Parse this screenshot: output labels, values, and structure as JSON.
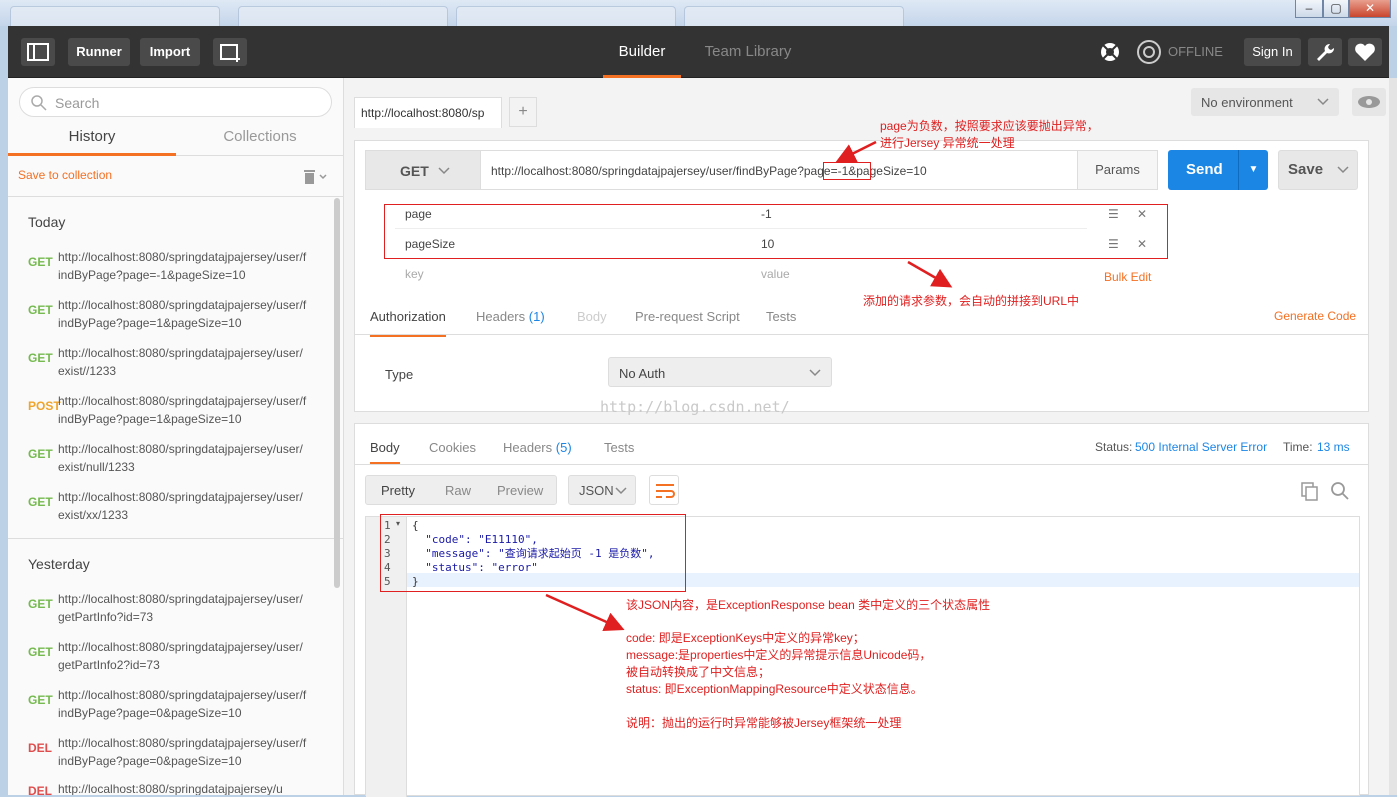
{
  "app": {
    "header": {
      "runner_label": "Runner",
      "import_label": "Import",
      "builder_tab": "Builder",
      "team_library_tab": "Team Library",
      "offline_label": "OFFLINE",
      "sign_in_label": "Sign In"
    },
    "sidebar": {
      "search_placeholder": "Search",
      "tabs": [
        "History",
        "Collections"
      ],
      "save_to_collection": "Save to collection",
      "today_label": "Today",
      "yesterday_label": "Yesterday",
      "today_items": [
        {
          "method": "GET",
          "url": "http://localhost:8080/springdatajpajersey/user/findByPage?page=-1&pageSize=10"
        },
        {
          "method": "GET",
          "url": "http://localhost:8080/springdatajpajersey/user/findByPage?page=1&pageSize=10"
        },
        {
          "method": "GET",
          "url": "http://localhost:8080/springdatajpajersey/user/exist//1233"
        },
        {
          "method": "POST",
          "url": "http://localhost:8080/springdatajpajersey/user/findByPage?page=1&pageSize=10"
        },
        {
          "method": "GET",
          "url": "http://localhost:8080/springdatajpajersey/user/exist/null/1233"
        },
        {
          "method": "GET",
          "url": "http://localhost:8080/springdatajpajersey/user/exist/xx/1233"
        }
      ],
      "yesterday_items": [
        {
          "method": "GET",
          "url": "http://localhost:8080/springdatajpajersey/user/getPartInfo?id=73"
        },
        {
          "method": "GET",
          "url": "http://localhost:8080/springdatajpajersey/user/getPartInfo2?id=73"
        },
        {
          "method": "GET",
          "url": "http://localhost:8080/springdatajpajersey/user/findByPage?page=0&pageSize=10"
        },
        {
          "method": "DEL",
          "url": "http://localhost:8080/springdatajpajersey/user/findByPage?page=0&pageSize=10"
        },
        {
          "method": "DEL",
          "url": "http://localhost:8080/springdatajpajersey/u"
        }
      ]
    },
    "request": {
      "tab_label": "http://localhost:8080/sp",
      "environment": "No environment",
      "method": "GET",
      "url": "http://localhost:8080/springdatajpajersey/user/findByPage?page=-1&pageSize=10",
      "params_label": "Params",
      "send_label": "Send",
      "save_label": "Save",
      "params": [
        {
          "key": "page",
          "value": "-1"
        },
        {
          "key": "pageSize",
          "value": "10"
        }
      ],
      "key_placeholder": "key",
      "value_placeholder": "value",
      "bulk_edit": "Bulk Edit",
      "tabs": {
        "authorization": "Authorization",
        "headers": "Headers",
        "headers_count": "(1)",
        "body": "Body",
        "prerequest": "Pre-request Script",
        "tests": "Tests"
      },
      "generate_code": "Generate Code",
      "type_label": "Type",
      "auth_type": "No Auth"
    },
    "response": {
      "tabs": {
        "body": "Body",
        "cookies": "Cookies",
        "headers": "Headers",
        "headers_count": "(5)",
        "tests": "Tests"
      },
      "status_label": "Status:",
      "status_value": "500 Internal Server Error",
      "time_label": "Time:",
      "time_value": "13 ms",
      "view_modes": [
        "Pretty",
        "Raw",
        "Preview"
      ],
      "format": "JSON",
      "code_lines": [
        "{",
        "  \"code\": \"E11110\",",
        "  \"message\": \"查询请求起始页 -1 是负数\",",
        "  \"status\": \"error\"",
        "}"
      ],
      "line_numbers": [
        "1",
        "2",
        "3",
        "4",
        "5"
      ]
    },
    "annotations": {
      "a1_line1": "page为负数，按照要求应该要抛出异常，",
      "a1_line2": "进行Jersey 异常统一处理",
      "a2": "添加的请求参数，会自动的拼接到URL中",
      "a3": "该JSON内容，是ExceptionResponse bean 类中定义的三个状态属性",
      "a4_1": "code: 即是ExceptionKeys中定义的异常key；",
      "a4_2": "message:是properties中定义的异常提示信息Unicode码，",
      "a4_3": "被自动转换成了中文信息；",
      "a4_4": "status: 即ExceptionMappingResource中定义状态信息。",
      "a5": "说明：抛出的运行时异常能够被Jersey框架统一处理",
      "watermark": "http://blog.csdn.net/"
    },
    "colors": {
      "accent": "#f47023",
      "send": "#1c86e5",
      "annotation": "#e02020"
    }
  }
}
